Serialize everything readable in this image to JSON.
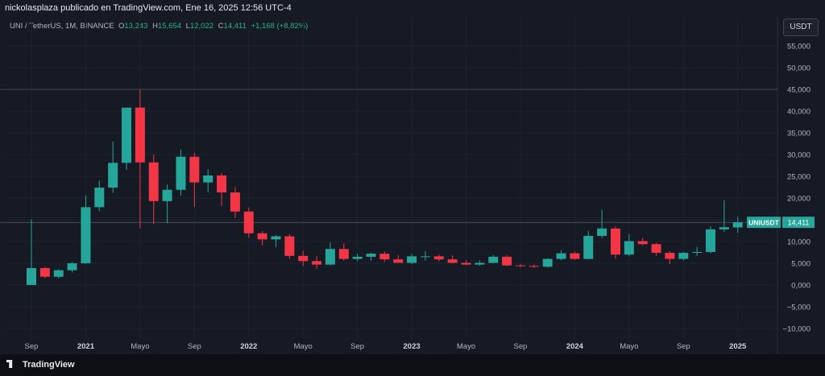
{
  "header": {
    "publisher_line": "nickolasplaza publicado en TradingView.com, Ene 16, 2025 12:56 UTC-4"
  },
  "symbol_info": {
    "name": "UNI / TetherUS, 1M, BINANCE",
    "open_label": "O",
    "open": "13,243",
    "high_label": "H",
    "high": "15,654",
    "low_label": "L",
    "low": "12,022",
    "close_label": "C",
    "close": "14,411",
    "change": "+1,168 (+8,82%)"
  },
  "currency_button": "USDT",
  "footer": {
    "logo_text": "TradingView"
  },
  "colors": {
    "up": "#26a69a",
    "down": "#f23645",
    "background": "#161a25",
    "axis_text": "#b2b5be"
  },
  "chart_data": {
    "type": "candlestick",
    "y_ticks": [
      55000,
      50000,
      45000,
      40000,
      35000,
      30000,
      25000,
      20000,
      15000,
      10000,
      5000,
      0,
      -5000,
      -10000
    ],
    "y_tick_labels": [
      "55,000",
      "50,000",
      "45,000",
      "40,000",
      "35,000",
      "30,000",
      "25,000",
      "20,000",
      "15,000",
      "10,000",
      "5,000",
      "0,000",
      "−5,000",
      "−10,000"
    ],
    "ylim": [
      -12000,
      59000
    ],
    "x_labels": [
      {
        "index": 0,
        "text": "Sep"
      },
      {
        "index": 4,
        "text": "2021"
      },
      {
        "index": 8,
        "text": "Mayo"
      },
      {
        "index": 12,
        "text": "Sep"
      },
      {
        "index": 16,
        "text": "2022"
      },
      {
        "index": 20,
        "text": "Mayo"
      },
      {
        "index": 24,
        "text": "Sep"
      },
      {
        "index": 28,
        "text": "2023"
      },
      {
        "index": 32,
        "text": "Mayo"
      },
      {
        "index": 36,
        "text": "Sep"
      },
      {
        "index": 40,
        "text": "2024"
      },
      {
        "index": 44,
        "text": "Mayo"
      },
      {
        "index": 48,
        "text": "Sep"
      },
      {
        "index": 52,
        "text": "2025"
      }
    ],
    "reference_lines": [
      45000,
      14411
    ],
    "last_price_label": {
      "symbol": "UNIUSDT",
      "value": "14,411",
      "price": 14411
    },
    "candles": [
      {
        "o": 0,
        "h": 15100,
        "l": 0,
        "c": 3900
      },
      {
        "o": 3900,
        "h": 4200,
        "l": 1600,
        "c": 1900
      },
      {
        "o": 1900,
        "h": 3600,
        "l": 1500,
        "c": 3400
      },
      {
        "o": 3400,
        "h": 5300,
        "l": 2900,
        "c": 5000
      },
      {
        "o": 5000,
        "h": 20600,
        "l": 4900,
        "c": 17900
      },
      {
        "o": 17900,
        "h": 24000,
        "l": 17000,
        "c": 22400
      },
      {
        "o": 22400,
        "h": 33000,
        "l": 21200,
        "c": 28100
      },
      {
        "o": 28100,
        "h": 35000,
        "l": 26500,
        "c": 40800
      },
      {
        "o": 40800,
        "h": 44900,
        "l": 13000,
        "c": 28200
      },
      {
        "o": 28200,
        "h": 30000,
        "l": 14000,
        "c": 19300
      },
      {
        "o": 19300,
        "h": 23200,
        "l": 14200,
        "c": 21900
      },
      {
        "o": 21900,
        "h": 31200,
        "l": 20600,
        "c": 29500
      },
      {
        "o": 29500,
        "h": 30400,
        "l": 18000,
        "c": 23600
      },
      {
        "o": 23600,
        "h": 26600,
        "l": 21300,
        "c": 25200
      },
      {
        "o": 25200,
        "h": 25700,
        "l": 18200,
        "c": 21300
      },
      {
        "o": 21300,
        "h": 22500,
        "l": 15400,
        "c": 16900
      },
      {
        "o": 16900,
        "h": 17800,
        "l": 10900,
        "c": 11900
      },
      {
        "o": 11900,
        "h": 12400,
        "l": 9100,
        "c": 10500
      },
      {
        "o": 10500,
        "h": 11500,
        "l": 8700,
        "c": 11200
      },
      {
        "o": 11200,
        "h": 11700,
        "l": 6000,
        "c": 6700
      },
      {
        "o": 6700,
        "h": 7900,
        "l": 4300,
        "c": 5500
      },
      {
        "o": 5500,
        "h": 6700,
        "l": 3700,
        "c": 4700
      },
      {
        "o": 4700,
        "h": 9800,
        "l": 4500,
        "c": 8300
      },
      {
        "o": 8300,
        "h": 9600,
        "l": 5600,
        "c": 6000
      },
      {
        "o": 6000,
        "h": 7200,
        "l": 5500,
        "c": 6500
      },
      {
        "o": 6500,
        "h": 7400,
        "l": 5600,
        "c": 7200
      },
      {
        "o": 7200,
        "h": 7700,
        "l": 5300,
        "c": 5900
      },
      {
        "o": 5900,
        "h": 6900,
        "l": 5100,
        "c": 5100
      },
      {
        "o": 5100,
        "h": 7200,
        "l": 4800,
        "c": 6600
      },
      {
        "o": 6600,
        "h": 7800,
        "l": 5600,
        "c": 6600
      },
      {
        "o": 6600,
        "h": 7000,
        "l": 5400,
        "c": 5900
      },
      {
        "o": 5900,
        "h": 6800,
        "l": 5000,
        "c": 5100
      },
      {
        "o": 5100,
        "h": 5800,
        "l": 4600,
        "c": 4700
      },
      {
        "o": 4700,
        "h": 5700,
        "l": 4400,
        "c": 5100
      },
      {
        "o": 5100,
        "h": 6900,
        "l": 5000,
        "c": 6500
      },
      {
        "o": 6500,
        "h": 6800,
        "l": 4400,
        "c": 4500
      },
      {
        "o": 4500,
        "h": 4800,
        "l": 4100,
        "c": 4400
      },
      {
        "o": 4400,
        "h": 4700,
        "l": 3900,
        "c": 4200
      },
      {
        "o": 4200,
        "h": 6200,
        "l": 4000,
        "c": 6000
      },
      {
        "o": 6000,
        "h": 8000,
        "l": 5700,
        "c": 7300
      },
      {
        "o": 7300,
        "h": 7700,
        "l": 5800,
        "c": 6000
      },
      {
        "o": 6000,
        "h": 12400,
        "l": 5900,
        "c": 11300
      },
      {
        "o": 11300,
        "h": 17300,
        "l": 10800,
        "c": 13000
      },
      {
        "o": 13000,
        "h": 13500,
        "l": 6100,
        "c": 7000
      },
      {
        "o": 7000,
        "h": 11700,
        "l": 6600,
        "c": 10100
      },
      {
        "o": 10100,
        "h": 10800,
        "l": 9200,
        "c": 9400
      },
      {
        "o": 9400,
        "h": 9700,
        "l": 6700,
        "c": 7400
      },
      {
        "o": 7400,
        "h": 7800,
        "l": 4800,
        "c": 6000
      },
      {
        "o": 6000,
        "h": 7600,
        "l": 5700,
        "c": 7400
      },
      {
        "o": 7400,
        "h": 8800,
        "l": 6700,
        "c": 7600
      },
      {
        "o": 7600,
        "h": 13500,
        "l": 7300,
        "c": 12800
      },
      {
        "o": 12800,
        "h": 19500,
        "l": 12200,
        "c": 13300
      },
      {
        "o": 13243,
        "h": 15654,
        "l": 12022,
        "c": 14411
      }
    ]
  }
}
